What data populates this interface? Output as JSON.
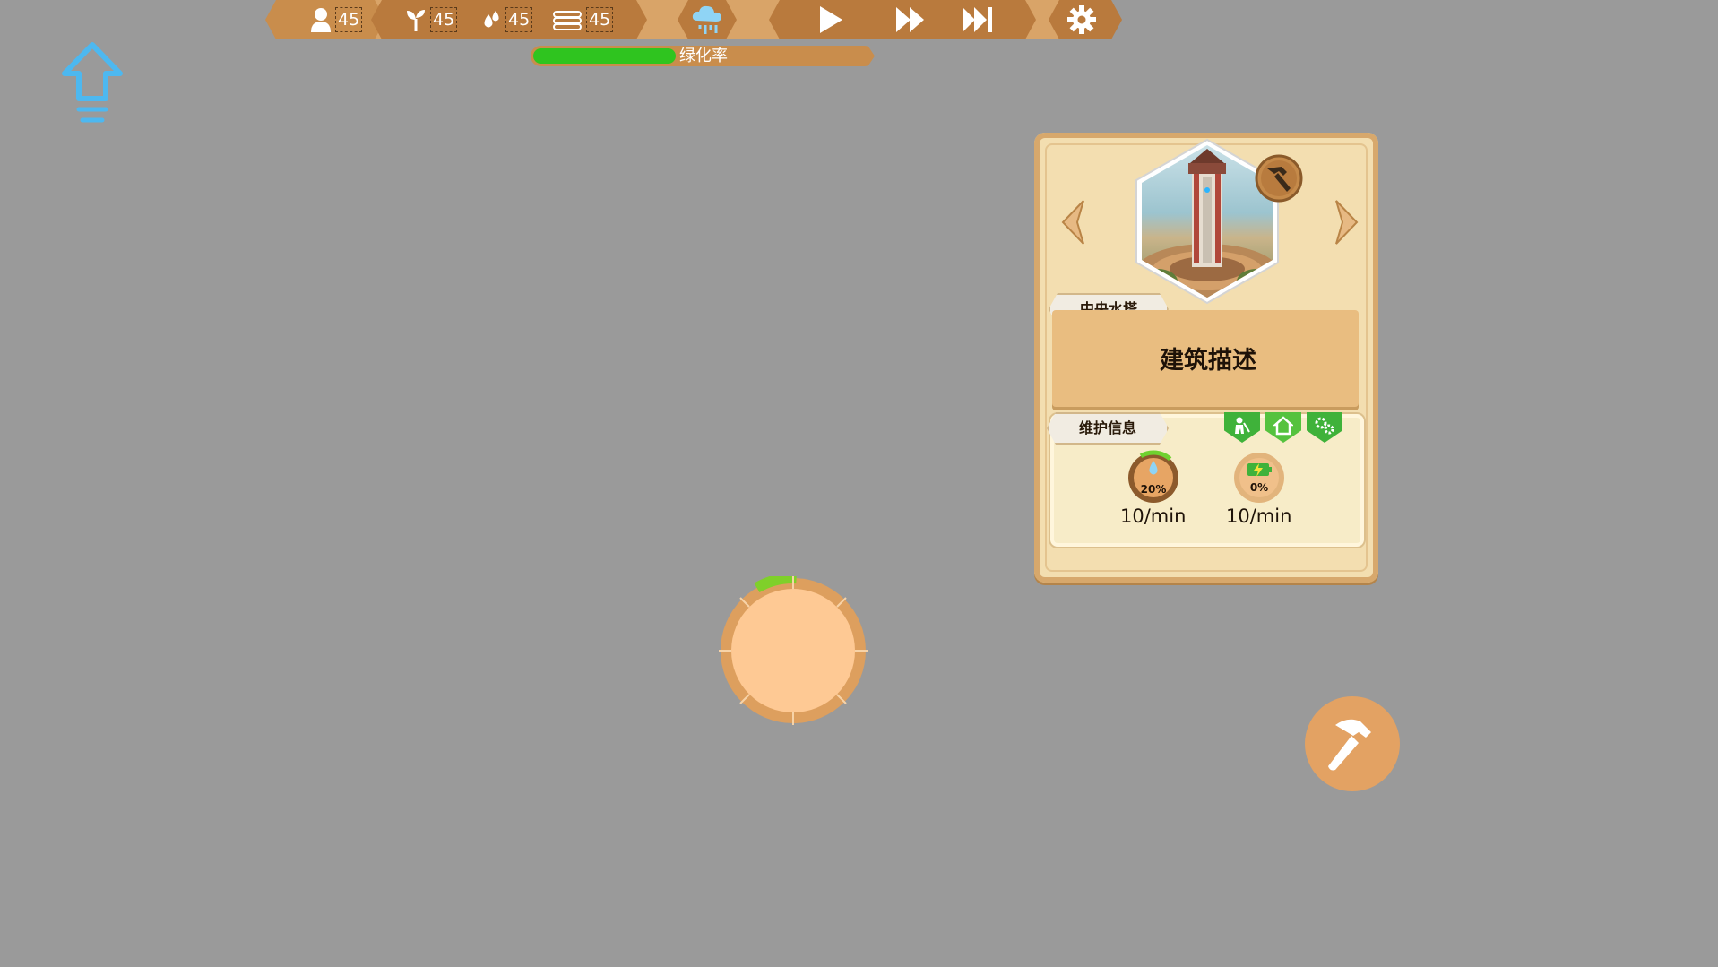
{
  "hud": {
    "population": "45",
    "plant": "45",
    "water": "45",
    "wood": "45",
    "icons": [
      "person-icon",
      "sprout-icon",
      "water-drops-icon",
      "wood-logs-icon",
      "rain-cloud-icon",
      "play-icon",
      "fast-forward-icon",
      "skip-forward-icon",
      "gear-icon"
    ]
  },
  "greening": {
    "label": "绿化率",
    "progress": 0.42,
    "color": "#2fc41f"
  },
  "building": {
    "name": "中央水塔",
    "description": "建筑描述",
    "maintenance_label": "维护信息",
    "stats": [
      {
        "icon": "water-drop-icon",
        "percent": "20%",
        "rate": "10/min"
      },
      {
        "icon": "battery-bolt-icon",
        "percent": "0%",
        "rate": "10/min"
      }
    ],
    "status_icons": [
      "worker-icon",
      "house-icon",
      "gears-icon"
    ]
  },
  "colors": {
    "background": "#9a9a9a",
    "hud_brown": "#c98d4c",
    "panel_cream": "#f3deb0",
    "accent_green": "#3fb23a",
    "blue_arrow": "#4db8f0"
  }
}
